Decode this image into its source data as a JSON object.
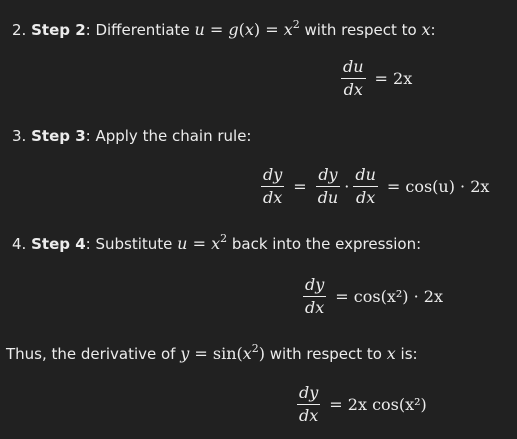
{
  "step2": {
    "number": "2.",
    "title": "Step 2",
    "text": ": Differentiate ",
    "math": "u = g(x) = x²",
    "suffix": " with respect to ",
    "var": "x",
    "end": ":"
  },
  "eq1": {
    "num": "du",
    "den": "dx",
    "rhs": "= 2x"
  },
  "step3": {
    "number": "3.",
    "title": "Step 3",
    "text": ": Apply the chain rule:"
  },
  "eq2": {
    "num1": "dy",
    "den1": "dx",
    "num2": "dy",
    "den2": "du",
    "num3": "du",
    "den3": "dx",
    "rhs": "= cos(u) · 2x"
  },
  "step4": {
    "number": "4.",
    "title": "Step 4",
    "text": ": Substitute ",
    "math": "u = x²",
    "suffix": " back into the expression:"
  },
  "eq3": {
    "num": "dy",
    "den": "dx",
    "rhs": "= cos(x²) · 2x"
  },
  "conclusion": {
    "prefix": "Thus, the derivative of ",
    "math": "y = sin(x²)",
    "suffix": " with respect to ",
    "var": "x",
    "end": " is:"
  },
  "eq4": {
    "num": "dy",
    "den": "dx",
    "rhs": "= 2x cos(x²)"
  }
}
